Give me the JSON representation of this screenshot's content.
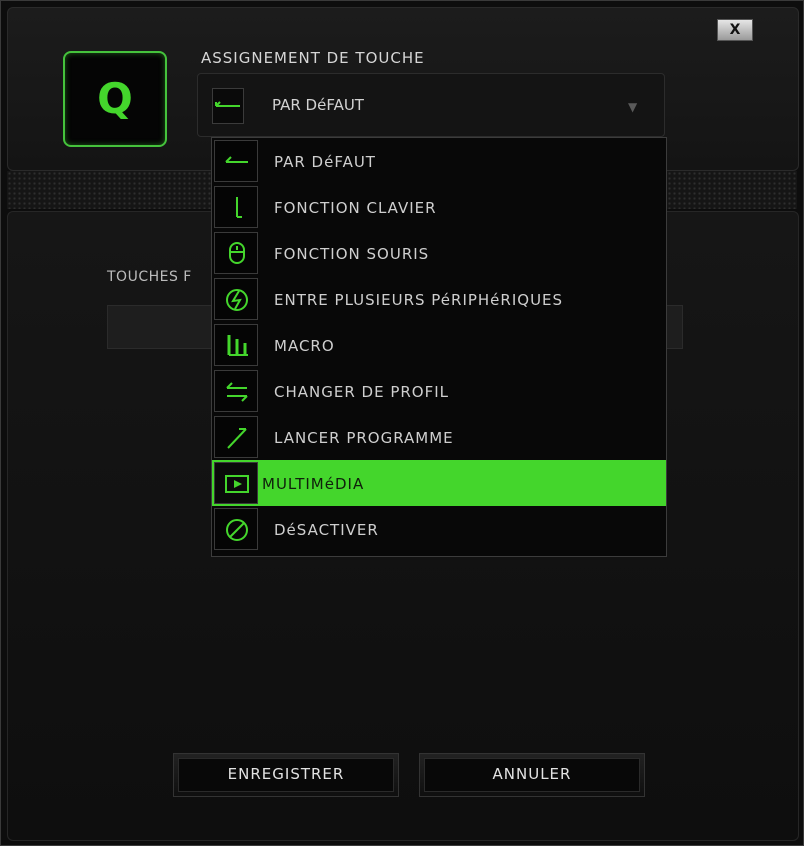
{
  "window": {
    "close_label": "X",
    "key_letter": "Q",
    "section_title": "ASSIGNEMENT DE TOUCHE"
  },
  "select": {
    "value": "PAR DéFAUT",
    "icon": "default-arrow-icon"
  },
  "background": {
    "label": "TOUCHES F"
  },
  "menu": {
    "items": [
      {
        "label": "PAR DéFAUT",
        "icon": "default-arrow-icon",
        "selected": false
      },
      {
        "label": "FONCTION CLAVIER",
        "icon": "keyboard-function-icon",
        "selected": false
      },
      {
        "label": "FONCTION SOURIS",
        "icon": "mouse-icon",
        "selected": false
      },
      {
        "label": "ENTRE PLUSIEURS PéRIPHéRIQUES",
        "icon": "inter-device-icon",
        "selected": false
      },
      {
        "label": "MACRO",
        "icon": "macro-icon",
        "selected": false
      },
      {
        "label": "CHANGER DE PROFIL",
        "icon": "switch-profile-icon",
        "selected": false
      },
      {
        "label": "LANCER PROGRAMME",
        "icon": "launch-program-icon",
        "selected": false
      },
      {
        "label": "MULTIMéDIA",
        "icon": "multimedia-icon",
        "selected": true
      },
      {
        "label": "DéSACTIVER",
        "icon": "disable-icon",
        "selected": false
      }
    ]
  },
  "buttons": {
    "save_label": "ENREGISTRER",
    "cancel_label": "ANNULER"
  },
  "colors": {
    "accent": "#44d62c",
    "background": "#0d0d0d"
  }
}
